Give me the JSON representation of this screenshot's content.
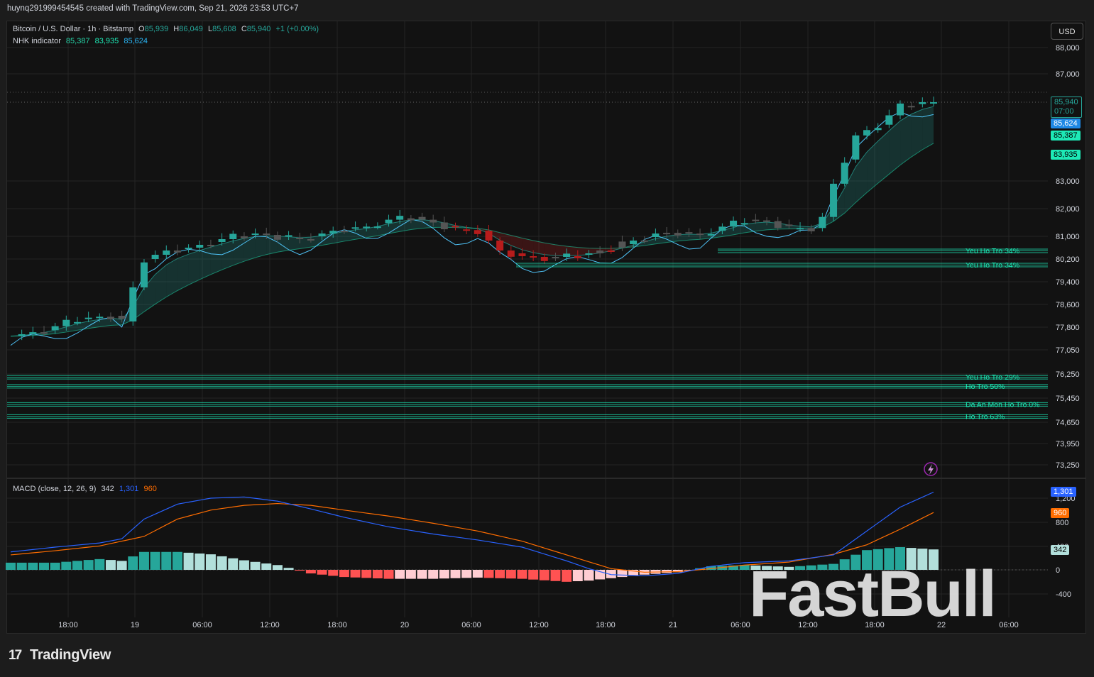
{
  "header": {
    "title": "huynq291999454545 created with TradingView.com, Sep 21, 2026 23:53 UTC+7"
  },
  "legend": {
    "symbol": "Bitcoin / U.S. Dollar · 1h · Bitstamp",
    "o_label": "O",
    "o_value": "85,939",
    "h_label": "H",
    "h_value": "86,049",
    "l_label": "L",
    "l_value": "85,608",
    "c_label": "C",
    "c_value": "85,940",
    "change": "+1 (+0.00%)",
    "indicator_name": "NHK indicator",
    "ind_v1": "85,387",
    "ind_v2": "83,935",
    "ind_v3": "85,624",
    "macd_name": "MACD (close, 12, 26, 9)",
    "macd_hist": "342",
    "macd_line": "1,301",
    "macd_signal": "960"
  },
  "currency_button": "USD",
  "price_tags": {
    "last": "85,940",
    "countdown": "07:00",
    "blue": "85,624",
    "green1": "85,387",
    "green2": "83,935",
    "macd_line": "1,301",
    "macd_signal": "960",
    "macd_hist": "342"
  },
  "colors": {
    "up": "#26a69a",
    "down": "#ef5350",
    "teal_line": "#22ab94",
    "macd_blue": "#2962ff",
    "macd_orange": "#ff6d00",
    "support": "#1de9b6"
  },
  "footer_brand": "TradingView",
  "watermark": "FastBull",
  "chart_data": [
    {
      "type": "candlestick",
      "title": "Bitcoin / U.S. Dollar · 1h · Bitstamp",
      "x_ticks": [
        "18:00",
        "19",
        "06:00",
        "12:00",
        "18:00",
        "20",
        "06:00",
        "12:00",
        "18:00",
        "21",
        "06:00",
        "12:00",
        "18:00",
        "22",
        "06:00"
      ],
      "y_ticks": [
        "88,000",
        "87,000",
        "83,000",
        "82,000",
        "81,000",
        "80,200",
        "79,400",
        "78,600",
        "77,800",
        "77,050",
        "76,250",
        "75,450",
        "74,650",
        "73,950",
        "73,250"
      ],
      "price_path": [
        [
          0,
          77500
        ],
        [
          3,
          77700
        ],
        [
          6,
          78100
        ],
        [
          9,
          78200
        ],
        [
          10,
          78000
        ],
        [
          11,
          79200
        ],
        [
          12,
          80200
        ],
        [
          14,
          80500
        ],
        [
          16,
          80600
        ],
        [
          18,
          80800
        ],
        [
          20,
          81000
        ],
        [
          22,
          81100
        ],
        [
          24,
          81000
        ],
        [
          26,
          80900
        ],
        [
          28,
          81100
        ],
        [
          30,
          81300
        ],
        [
          32,
          81350
        ],
        [
          34,
          81600
        ],
        [
          36,
          81700
        ],
        [
          38,
          81500
        ],
        [
          40,
          81250
        ],
        [
          42,
          81200
        ],
        [
          44,
          80500
        ],
        [
          46,
          80300
        ],
        [
          48,
          80250
        ],
        [
          50,
          80300
        ],
        [
          52,
          80400
        ],
        [
          54,
          80600
        ],
        [
          56,
          80850
        ],
        [
          58,
          81100
        ],
        [
          60,
          81150
        ],
        [
          62,
          81050
        ],
        [
          64,
          81350
        ],
        [
          66,
          81600
        ],
        [
          68,
          81550
        ],
        [
          70,
          81300
        ],
        [
          72,
          81300
        ],
        [
          73,
          81700
        ],
        [
          74,
          82900
        ],
        [
          76,
          84700
        ],
        [
          78,
          85100
        ],
        [
          80,
          85800
        ],
        [
          82,
          85940
        ]
      ],
      "support_levels": [
        {
          "label": "Yeu Ho Tro 34%",
          "value": 80550
        },
        {
          "label": "Yeu Ho Tro 34%",
          "value": 80050
        },
        {
          "label": "Yeu Ho Tro 29%",
          "value": 76200
        },
        {
          "label": "Ho Tro 50%",
          "value": 75900
        },
        {
          "label": "Da An Mon Ho Tro 0%",
          "value": 75300
        },
        {
          "label": "Ho Tro 63%",
          "value": 74900
        }
      ]
    },
    {
      "type": "bar",
      "title": "MACD (close, 12, 26, 9)",
      "y_ticks": [
        "1,200",
        "800",
        "400",
        "0",
        "-400"
      ],
      "macd_line": [
        [
          0,
          300
        ],
        [
          4,
          380
        ],
        [
          8,
          450
        ],
        [
          10,
          520
        ],
        [
          12,
          850
        ],
        [
          15,
          1100
        ],
        [
          18,
          1200
        ],
        [
          21,
          1220
        ],
        [
          24,
          1150
        ],
        [
          27,
          1020
        ],
        [
          30,
          880
        ],
        [
          34,
          720
        ],
        [
          38,
          600
        ],
        [
          42,
          500
        ],
        [
          46,
          380
        ],
        [
          50,
          150
        ],
        [
          52,
          20
        ],
        [
          54,
          -80
        ],
        [
          57,
          -100
        ],
        [
          60,
          -60
        ],
        [
          63,
          60
        ],
        [
          66,
          120
        ],
        [
          70,
          150
        ],
        [
          74,
          250
        ],
        [
          77,
          650
        ],
        [
          80,
          1050
        ],
        [
          83,
          1301
        ]
      ],
      "signal_line": [
        [
          0,
          250
        ],
        [
          4,
          320
        ],
        [
          8,
          400
        ],
        [
          12,
          560
        ],
        [
          15,
          850
        ],
        [
          18,
          1000
        ],
        [
          21,
          1080
        ],
        [
          24,
          1110
        ],
        [
          27,
          1080
        ],
        [
          30,
          1000
        ],
        [
          34,
          900
        ],
        [
          38,
          780
        ],
        [
          42,
          650
        ],
        [
          46,
          480
        ],
        [
          50,
          250
        ],
        [
          54,
          20
        ],
        [
          57,
          -40
        ],
        [
          60,
          -30
        ],
        [
          63,
          20
        ],
        [
          66,
          80
        ],
        [
          70,
          130
        ],
        [
          74,
          260
        ],
        [
          77,
          420
        ],
        [
          80,
          680
        ],
        [
          83,
          960
        ]
      ],
      "histogram": [
        [
          0,
          120
        ],
        [
          4,
          120
        ],
        [
          8,
          180
        ],
        [
          10,
          150
        ],
        [
          12,
          300
        ],
        [
          15,
          300
        ],
        [
          18,
          260
        ],
        [
          21,
          160
        ],
        [
          24,
          80
        ],
        [
          27,
          -60
        ],
        [
          30,
          -120
        ],
        [
          34,
          -150
        ],
        [
          38,
          -150
        ],
        [
          42,
          -130
        ],
        [
          46,
          -150
        ],
        [
          50,
          -200
        ],
        [
          52,
          -180
        ],
        [
          54,
          -140
        ],
        [
          57,
          -80
        ],
        [
          60,
          -40
        ],
        [
          63,
          60
        ],
        [
          66,
          80
        ],
        [
          70,
          50
        ],
        [
          74,
          100
        ],
        [
          77,
          330
        ],
        [
          80,
          380
        ],
        [
          83,
          342
        ]
      ]
    }
  ]
}
